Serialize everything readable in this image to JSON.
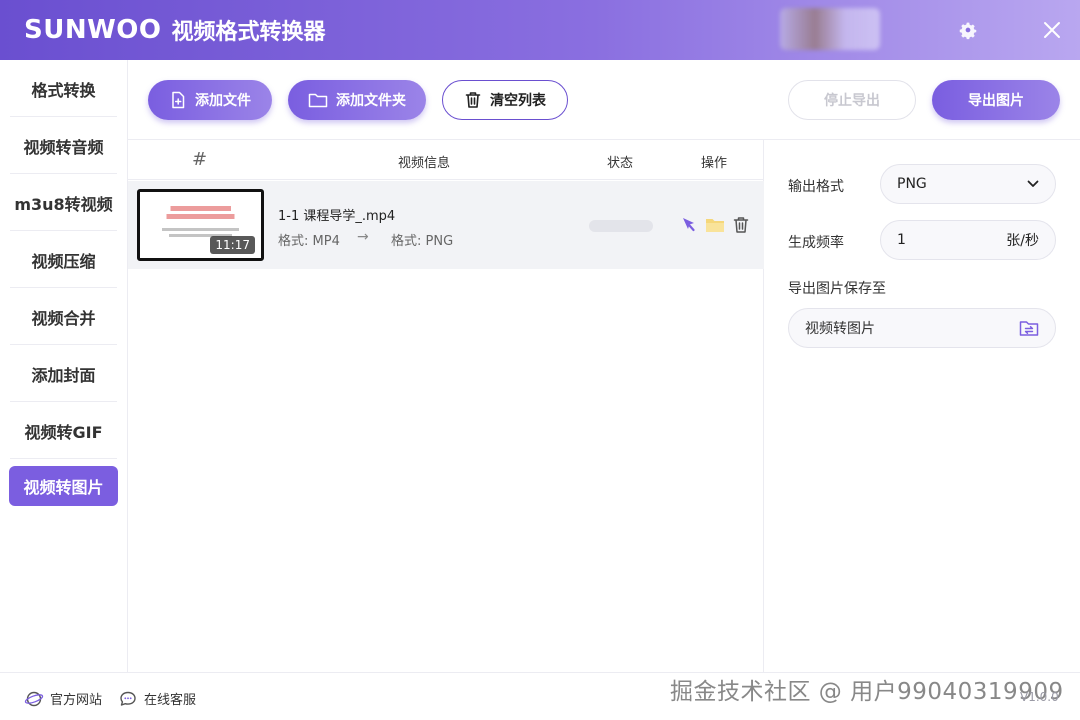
{
  "titlebar": {
    "brand": "SUNWOO",
    "title": "视频格式转换器"
  },
  "sidebar": {
    "items": [
      {
        "label": "格式转换"
      },
      {
        "label": "视频转音频"
      },
      {
        "label": "m3u8转视频"
      },
      {
        "label": "视频压缩"
      },
      {
        "label": "视频合并"
      },
      {
        "label": "添加封面"
      },
      {
        "label": "视频转GIF"
      },
      {
        "label": "视频转图片",
        "active": true
      }
    ]
  },
  "toolbar": {
    "add_file": "添加文件",
    "add_folder": "添加文件夹",
    "clear_list": "清空列表",
    "stop_export": "停止导出",
    "export_images": "导出图片"
  },
  "table": {
    "headers": {
      "index": "#",
      "info": "视频信息",
      "status": "状态",
      "actions": "操作"
    },
    "rows": [
      {
        "file_name": "1-1 课程导学_.mp4",
        "from_format": "格式: MP4",
        "to_format": "格式: PNG",
        "duration": "11:17",
        "progress": 0
      }
    ]
  },
  "settings": {
    "output_format_label": "输出格式",
    "output_format_value": "PNG",
    "frequency_label": "生成频率",
    "frequency_value": "1",
    "frequency_unit": "张/秒",
    "save_to_label": "导出图片保存至",
    "save_path": "视频转图片"
  },
  "footer": {
    "website": "官方网站",
    "support": "在线客服",
    "watermark": "掘金技术社区 @ 用户99040319909",
    "version": "V1.0.0"
  },
  "colors": {
    "accent": "#7b5ee0",
    "folder": "#f5d77a"
  }
}
